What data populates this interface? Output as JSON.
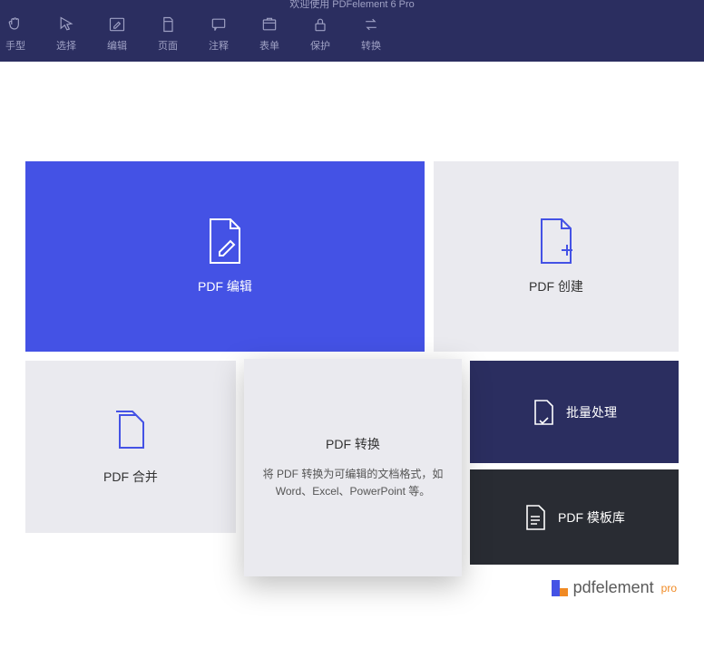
{
  "title": "欢迎使用 PDFelement 6 Pro",
  "toolbar": [
    {
      "label": "手型"
    },
    {
      "label": "选择"
    },
    {
      "label": "编辑"
    },
    {
      "label": "页面"
    },
    {
      "label": "注释"
    },
    {
      "label": "表单"
    },
    {
      "label": "保护"
    },
    {
      "label": "转换"
    }
  ],
  "tiles": {
    "edit": {
      "label": "PDF 编辑"
    },
    "create": {
      "label": "PDF 创建"
    },
    "combine": {
      "label": "PDF 合并"
    },
    "batch": {
      "label": "批量处理"
    },
    "template": {
      "label": "PDF 模板库"
    }
  },
  "popup": {
    "title": "PDF 转换",
    "desc": "将 PDF 转换为可编辑的文档格式，如 Word、Excel、PowerPoint 等。"
  },
  "branding": {
    "name": "pdfelement",
    "suffix": "pro"
  }
}
